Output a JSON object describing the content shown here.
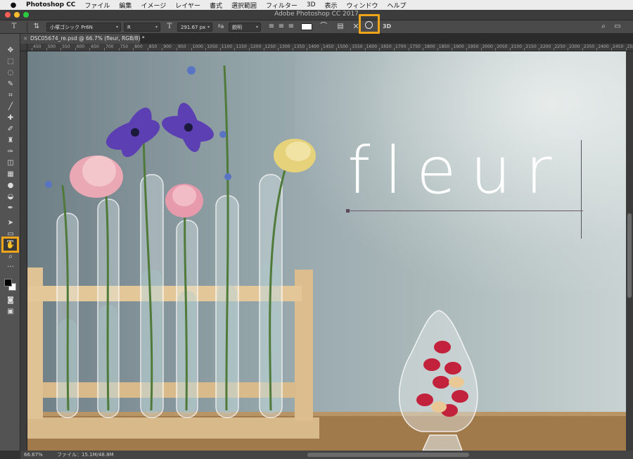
{
  "menubar": {
    "app_name": "Photoshop CC",
    "items": [
      "ファイル",
      "編集",
      "イメージ",
      "レイヤー",
      "書式",
      "選択範囲",
      "フィルター",
      "3D",
      "表示",
      "ウィンドウ",
      "ヘルプ"
    ]
  },
  "window": {
    "title": "Adobe Photoshop CC 2017"
  },
  "options_bar": {
    "tool_icon": "T",
    "font_family": "小塚ゴシック Pr6N",
    "font_style": "R",
    "font_size": "291.67 px",
    "anti_alias": "鋭明",
    "text_color": "#ffffff",
    "cancel_glyph": "✕",
    "three_d_label": "3D"
  },
  "document": {
    "tab_label": "DSC05674_re.psd @ 66.7% (fleur, RGB/8) *",
    "close_glyph": "×"
  },
  "ruler": {
    "labels": [
      "450",
      "500",
      "550",
      "600",
      "650",
      "700",
      "750",
      "800",
      "850",
      "900",
      "950",
      "1000",
      "1050",
      "1100",
      "1150",
      "1200",
      "1250",
      "1300",
      "1350",
      "1400",
      "1450",
      "1500",
      "1550",
      "1600",
      "1650",
      "1700",
      "1750",
      "1800",
      "1850",
      "1900",
      "1950",
      "2000",
      "2050",
      "2100",
      "2150",
      "2200",
      "2250",
      "2300",
      "2350",
      "2400",
      "2450",
      "2500"
    ]
  },
  "canvas": {
    "text_layer": "fleur"
  },
  "status": {
    "zoom": "66.67%",
    "file_info": "ファイル：15.1M/48.8M"
  },
  "colors": {
    "highlight": "#efa519",
    "foreground": "#000000",
    "background": "#ffffff"
  }
}
